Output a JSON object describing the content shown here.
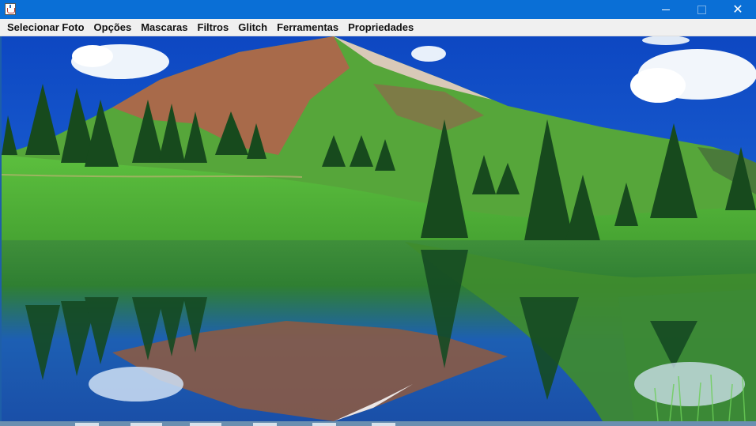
{
  "window": {
    "icon": "java-cup-icon",
    "controls": {
      "minimize": "minimize-icon",
      "maximize": "maximize-icon",
      "close": "close-icon",
      "close_glyph": "✕"
    }
  },
  "menu": {
    "items": [
      "Selecionar Foto",
      "Opções",
      "Mascaras",
      "Filtros",
      "Glitch",
      "Ferramentas",
      "Propriedades"
    ]
  },
  "image": {
    "subject": "mountain-lake-landscape",
    "colors": {
      "sky": "#1553c8",
      "meadow": "#4fae3a",
      "water": "#1f5db8",
      "rock": "#a86a4a"
    }
  },
  "colors": {
    "titlebar": "#0a6fd6",
    "menubar": "#f0f0f0"
  }
}
